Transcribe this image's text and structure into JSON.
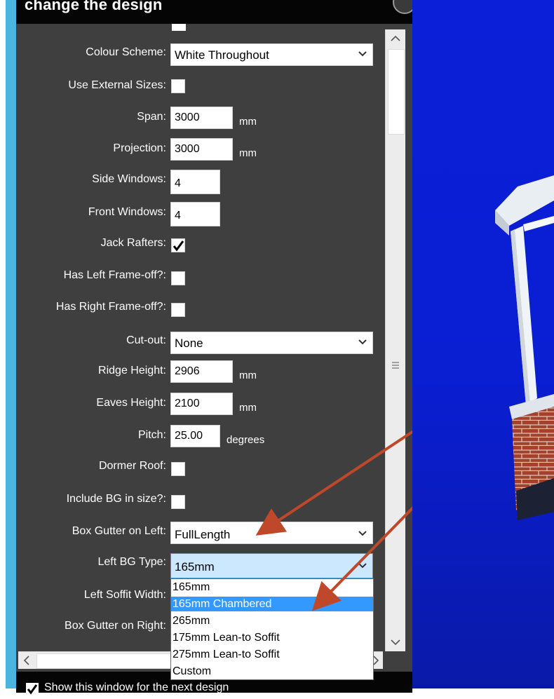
{
  "window": {
    "title": "change the design"
  },
  "form": {
    "colour_scheme": {
      "label": "Colour Scheme:",
      "value": "White Throughout"
    },
    "use_external_sizes": {
      "label": "Use External Sizes:",
      "checked": false
    },
    "span": {
      "label": "Span:",
      "value": "3000",
      "unit": "mm"
    },
    "projection": {
      "label": "Projection:",
      "value": "3000",
      "unit": "mm"
    },
    "side_windows": {
      "label": "Side Windows:",
      "value": "4"
    },
    "front_windows": {
      "label": "Front Windows:",
      "value": "4"
    },
    "jack_rafters": {
      "label": "Jack Rafters:",
      "checked": true
    },
    "has_left_frame_off": {
      "label": "Has Left Frame-off?:",
      "checked": false
    },
    "has_right_frame_off": {
      "label": "Has Right Frame-off?:",
      "checked": false
    },
    "cut_out": {
      "label": "Cut-out:",
      "value": "None"
    },
    "ridge_height": {
      "label": "Ridge Height:",
      "value": "2906",
      "unit": "mm"
    },
    "eaves_height": {
      "label": "Eaves Height:",
      "value": "2100",
      "unit": "mm"
    },
    "pitch": {
      "label": "Pitch:",
      "value": "25.00",
      "unit": "degrees"
    },
    "dormer_roof": {
      "label": "Dormer Roof:",
      "checked": false
    },
    "include_bg_in_size": {
      "label": "Include BG in size?:",
      "checked": false
    },
    "box_gutter_left": {
      "label": "Box Gutter on Left:",
      "value": "FullLength"
    },
    "left_bg_type": {
      "label": "Left BG Type:",
      "value": "165mm",
      "options": [
        "165mm",
        "165mm Chambered",
        "265mm",
        "175mm Lean-to Soffit",
        "275mm Lean-to Soffit",
        "Custom"
      ],
      "highlighted": "165mm Chambered"
    },
    "left_soffit_width": {
      "label": "Left Soffit Width:"
    },
    "box_gutter_right": {
      "label": "Box Gutter on Right:"
    }
  },
  "footer": {
    "label": "Show this window for the next design",
    "checked": true
  },
  "colors": {
    "panel": "#3f3f3f",
    "accent": "#49b6e1",
    "highlight": "#3399ff",
    "arrow": "#c0482a"
  }
}
